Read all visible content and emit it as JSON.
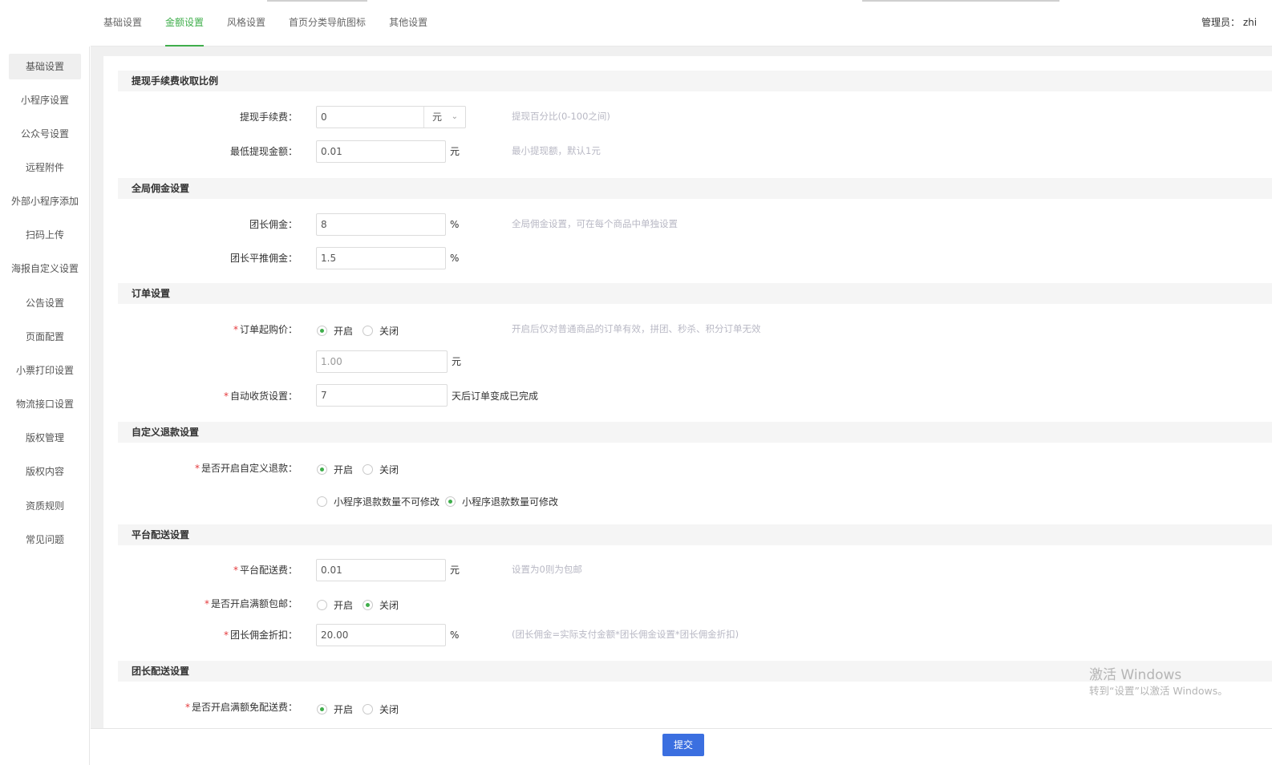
{
  "topbar": {
    "tabs": [
      "基础设置",
      "金额设置",
      "风格设置",
      "首页分类导航图标",
      "其他设置"
    ],
    "active_tab": 1,
    "admin": "管理员：  zhi"
  },
  "sidebar": {
    "items": [
      "基础设置",
      "小程序设置",
      "公众号设置",
      "远程附件",
      "外部小程序添加",
      "扫码上传",
      "海报自定义设置",
      "公告设置",
      "页面配置",
      "小票打印设置",
      "物流接口设置",
      "版权管理",
      "版权内容",
      "资质规则",
      "常见问题"
    ],
    "active": 0
  },
  "sections": {
    "withdraw": "提现手续费收取比例",
    "commission": "全局佣金设置",
    "order": "订单设置",
    "refund": "自定义退款设置",
    "delivery": "平台配送设置",
    "leader_delivery": "团长配送设置"
  },
  "withdraw": {
    "fee_label": "提现手续费：",
    "fee_value": "0",
    "fee_unit_select": "元",
    "fee_hint": "提现百分比(0-100之间)",
    "min_label": "最低提现金额：",
    "min_value": "0.01",
    "min_unit": "元",
    "min_hint": "最小提现额，默认1元"
  },
  "commission": {
    "leader_label": "团长佣金：",
    "leader_value": "8",
    "leader_unit": "%",
    "leader_hint": "全局佣金设置，可在每个商品中单独设置",
    "level_label": "团长平推佣金：",
    "level_value": "1.5",
    "level_unit": "%"
  },
  "order": {
    "min_label": "订单起购价：",
    "on": "开启",
    "off": "关闭",
    "min_hint": "开启后仅对普通商品的订单有效，拼团、秒杀、积分订单无效",
    "min_value": "1.00",
    "min_unit": "元",
    "auto_label": "自动收货设置：",
    "auto_value": "7",
    "auto_unit": "天后订单变成已完成"
  },
  "refund": {
    "enable_label": "是否开启自定义退款：",
    "on": "开启",
    "off": "关闭",
    "qty_fixed": "小程序退款数量不可修改",
    "qty_editable": "小程序退款数量可修改"
  },
  "delivery": {
    "fee_label": "平台配送费：",
    "fee_value": "0.01",
    "fee_unit": "元",
    "fee_hint": "设置为0则为包邮",
    "free_label": "是否开启满额包邮：",
    "on": "开启",
    "off": "关闭",
    "discount_label": "团长佣金折扣：",
    "discount_value": "20.00",
    "discount_unit": "%",
    "discount_hint": "(团长佣金=实际支付金额*团长佣金设置*团长佣金折扣)"
  },
  "leader_delivery": {
    "free_label": "是否开启满额免配送费：",
    "on": "开启",
    "off": "关闭"
  },
  "footer": {
    "submit": "提交"
  },
  "watermark": {
    "line1": "激活 Windows",
    "line2": "转到“设置”以激活 Windows。"
  },
  "colors": {
    "accent": "#3fae4b",
    "primary_button": "#3b6fe0",
    "required": "#e4393c",
    "hint": "#b8b8c4"
  }
}
